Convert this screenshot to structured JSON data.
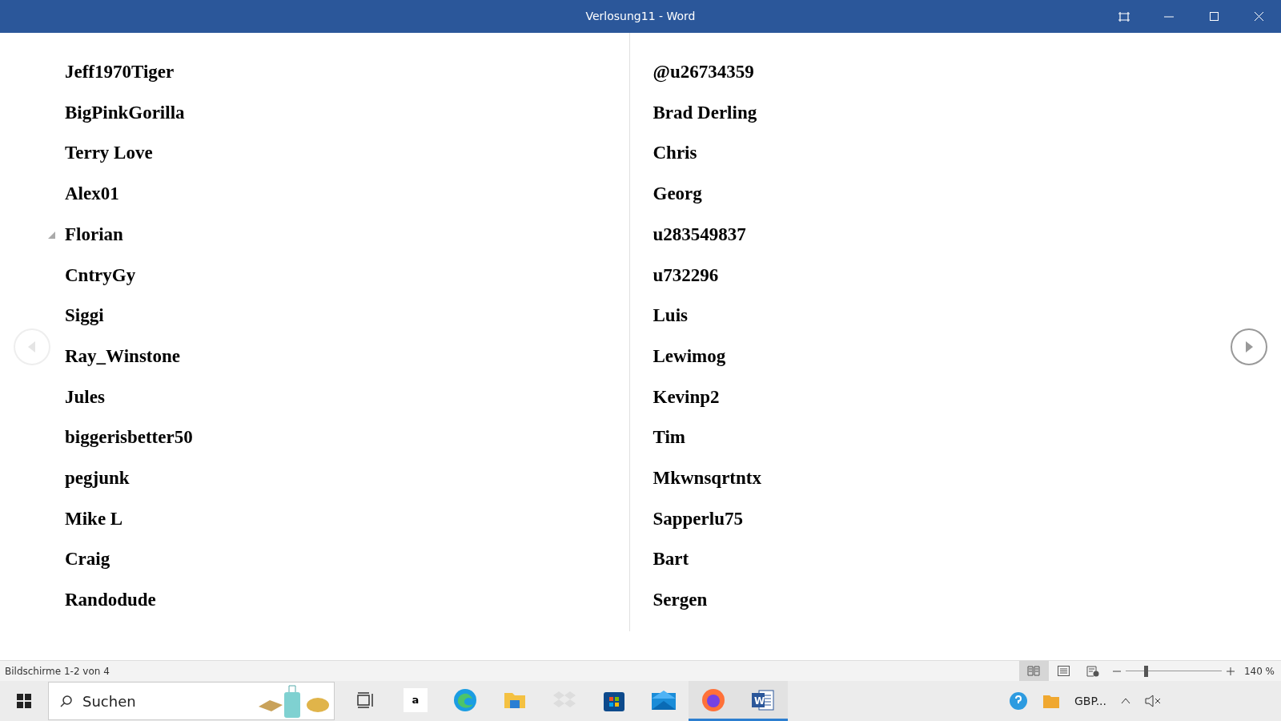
{
  "window": {
    "title": "Verlosung11  -  Word"
  },
  "document": {
    "columns": [
      {
        "items": [
          {
            "text": "Jeff1970Tiger",
            "collapse_marker": false
          },
          {
            "text": "BigPinkGorilla",
            "collapse_marker": false
          },
          {
            "text": "Terry Love",
            "collapse_marker": false
          },
          {
            "text": "Alex01",
            "collapse_marker": false
          },
          {
            "text": "Florian",
            "collapse_marker": true
          },
          {
            "text": "CntryGy",
            "collapse_marker": false
          },
          {
            "text": "Siggi",
            "collapse_marker": false
          },
          {
            "text": "Ray_Winstone",
            "collapse_marker": false
          },
          {
            "text": "Jules",
            "collapse_marker": false
          },
          {
            "text": "biggerisbetter50",
            "collapse_marker": false
          },
          {
            "text": "pegjunk",
            "collapse_marker": false
          },
          {
            "text": "Mike L",
            "collapse_marker": false
          },
          {
            "text": "Craig",
            "collapse_marker": false
          },
          {
            "text": "Randodude",
            "collapse_marker": false
          }
        ]
      },
      {
        "items": [
          {
            "text": "@u26734359",
            "collapse_marker": false
          },
          {
            "text": "Brad Derling",
            "collapse_marker": false
          },
          {
            "text": "Chris",
            "collapse_marker": false
          },
          {
            "text": "Georg",
            "collapse_marker": false
          },
          {
            "text": "u283549837",
            "collapse_marker": false
          },
          {
            "text": "u732296",
            "collapse_marker": false
          },
          {
            "text": "Luis",
            "collapse_marker": false
          },
          {
            "text": "Lewimog",
            "collapse_marker": false
          },
          {
            "text": "Kevinp2",
            "collapse_marker": false
          },
          {
            "text": "Tim",
            "collapse_marker": false
          },
          {
            "text": "Mkwnsqrtntx",
            "collapse_marker": false
          },
          {
            "text": "Sapperlu75",
            "collapse_marker": false
          },
          {
            "text": "Bart",
            "collapse_marker": false
          },
          {
            "text": "Sergen",
            "collapse_marker": false
          }
        ]
      }
    ],
    "prev_enabled": false,
    "next_enabled": true
  },
  "status_bar": {
    "page_info": "Bildschirme 1-2 von 4",
    "views": [
      {
        "kind": "read",
        "selected": true
      },
      {
        "kind": "print",
        "selected": false
      },
      {
        "kind": "web",
        "selected": false
      }
    ],
    "zoom": {
      "level": 0.21,
      "label": "140 %"
    }
  },
  "taskbar": {
    "search": {
      "placeholder": "Suchen"
    },
    "apps": [
      {
        "kind": "taskview",
        "active": false
      },
      {
        "kind": "amazon",
        "label": "a",
        "active": false
      },
      {
        "kind": "edge",
        "active": false
      },
      {
        "kind": "explorer",
        "active": false
      },
      {
        "kind": "dropbox",
        "active": false
      },
      {
        "kind": "store",
        "active": false
      },
      {
        "kind": "mail",
        "active": false
      },
      {
        "kind": "firefox",
        "active": true
      },
      {
        "kind": "word",
        "label": "W",
        "active": true
      }
    ],
    "tray_text": "GBP..."
  }
}
